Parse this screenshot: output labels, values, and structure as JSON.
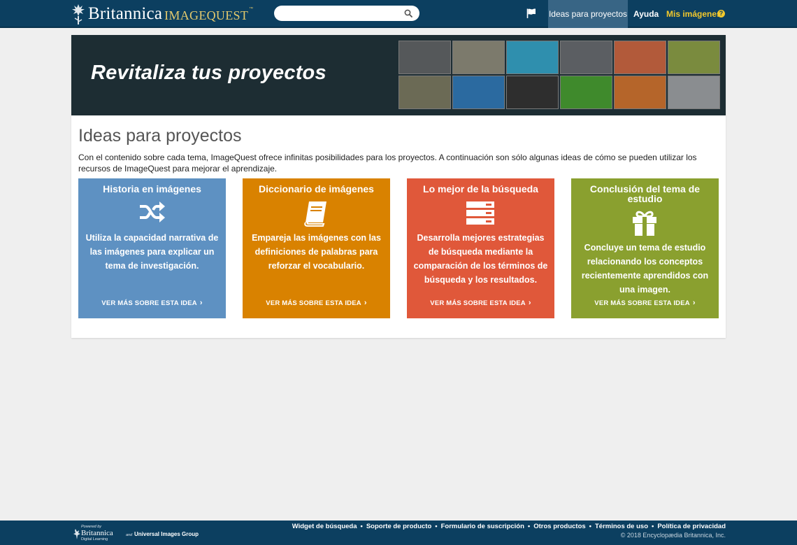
{
  "header": {
    "logo_brand": "Britannica",
    "logo_product": "IMAGEQUEST",
    "logo_tm": "™",
    "search_value": "",
    "nav": {
      "ideas": "Ideas para proyectos",
      "help": "Ayuda",
      "my_images": "Mis imágenes",
      "help_icon_glyph": "?"
    }
  },
  "banner": {
    "title": "Revitaliza tus proyectos",
    "thumbnails": [
      {
        "name": "crab-skull-thumbnail",
        "color": "#55585a"
      },
      {
        "name": "great-wall-thumbnail",
        "color": "#7c7a6c"
      },
      {
        "name": "red-cable-thumbnail",
        "color": "#2f8fae"
      },
      {
        "name": "buildings-thumbnail",
        "color": "#5b5e62"
      },
      {
        "name": "canyon-sunset-thumbnail",
        "color": "#b25a3a"
      },
      {
        "name": "frogs-thumbnail",
        "color": "#7a8b3e"
      },
      {
        "name": "painting-thumbnail",
        "color": "#6b6a55"
      },
      {
        "name": "server-rack-thumbnail",
        "color": "#2b6aa0"
      },
      {
        "name": "woman-portrait-thumbnail",
        "color": "#2e2e2e"
      },
      {
        "name": "tree-frog-thumbnail",
        "color": "#3f8a2c"
      },
      {
        "name": "cells-thumbnail",
        "color": "#b5652a"
      },
      {
        "name": "mountains-thumbnail",
        "color": "#8a8d90"
      }
    ]
  },
  "main": {
    "title": "Ideas para proyectos",
    "intro": "Con el contenido sobre cada tema, ImageQuest ofrece infinitas posibilidades para los proyectos. A continuación son sólo algunas ideas de cómo se pueden utilizar los recursos de ImageQuest para mejorar el aprendizaje.",
    "link_label": "VER MÁS SOBRE ESTA IDEA",
    "cards": [
      {
        "title": "Historia en imágenes",
        "icon": "shuffle-icon",
        "text": "Utiliza la capacidad narrativa de las imágenes para explicar un tema de investigación.",
        "color": "#5e91c2"
      },
      {
        "title": "Diccionario de imágenes",
        "icon": "book-icon",
        "text": "Empareja las imágenes con las definiciones de palabras para reforzar el vocabulario.",
        "color": "#d98200"
      },
      {
        "title": "Lo mejor de la búsqueda",
        "icon": "server-list-icon",
        "text": "Desarrolla mejores estrategias de búsqueda mediante la comparación de los términos de búsqueda y los resultados.",
        "color": "#e0583a"
      },
      {
        "title": "Conclusión del tema de estudio",
        "icon": "gift-icon",
        "text": "Concluye un tema de estudio relacionando los conceptos recientemente aprendidos con una imagen.",
        "color": "#8aa02f"
      }
    ]
  },
  "footer": {
    "links": [
      "Widget de búsqueda",
      "Soporte de producto",
      "Formulario de suscripción",
      "Otros productos",
      "Términos de uso",
      "Política de privacidad"
    ],
    "separator": "•",
    "copyright": "© 2018 Encyclopædia Britannica, Inc.",
    "powered_by": "Powered by",
    "partner_brand": "Britannica",
    "partner_sub": "Digital Learning",
    "partner_and": "and",
    "partner_second": "Universal Images Group"
  },
  "colors": {
    "header_bg": "#0c3f60",
    "nav_active_bg": "#386585",
    "accent_yellow": "#f2c82c",
    "banner_bg": "#1d2d33"
  }
}
